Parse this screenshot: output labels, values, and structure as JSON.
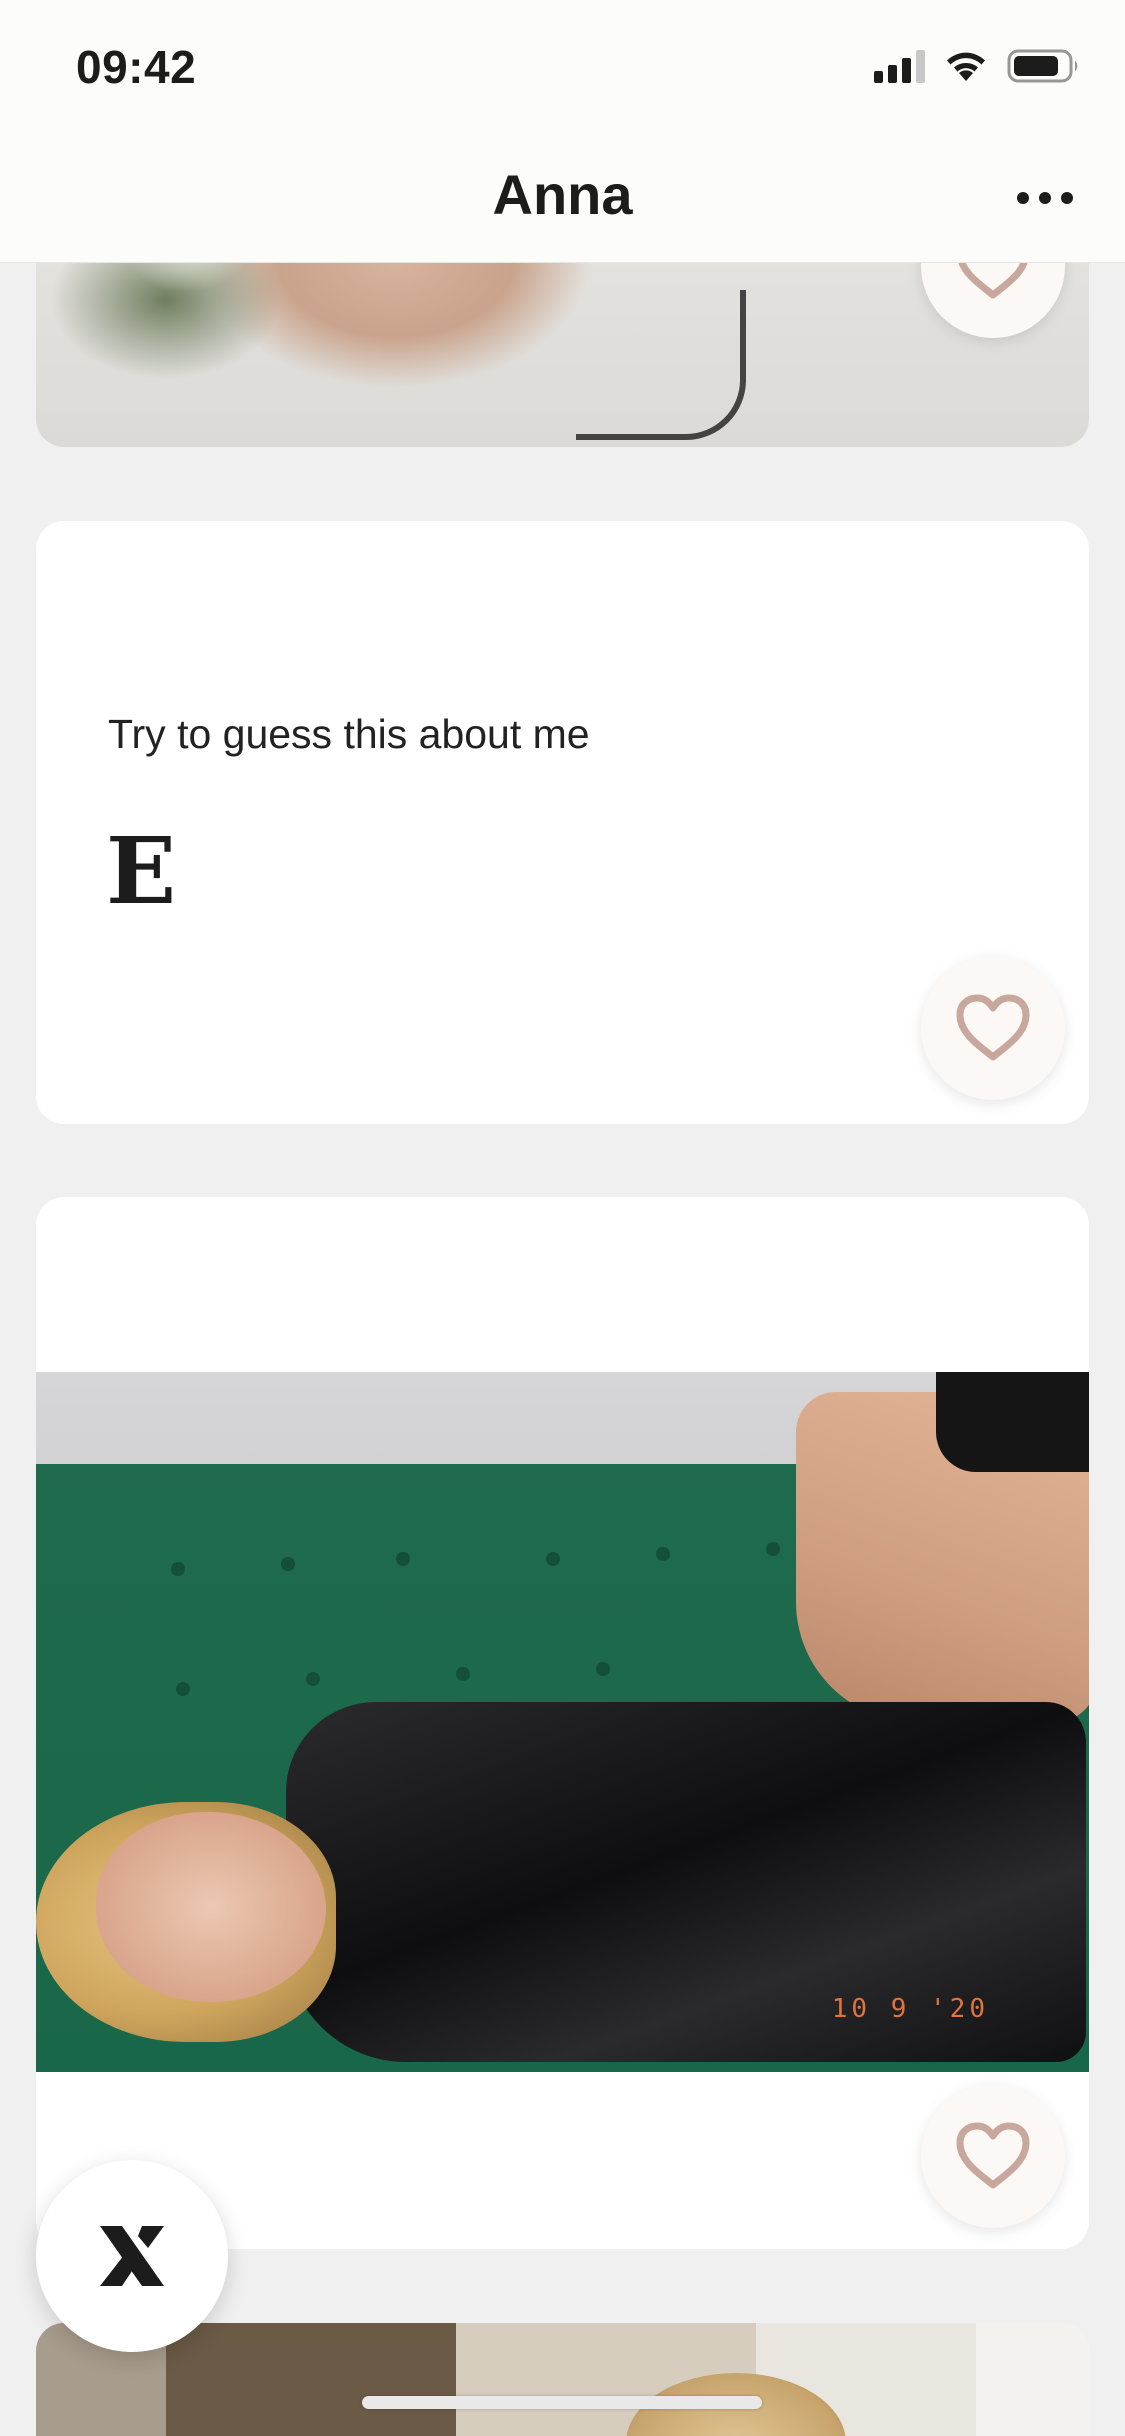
{
  "status_bar": {
    "time": "09:42"
  },
  "header": {
    "title": "Anna"
  },
  "prompt_card": {
    "label": "Try to guess this about me",
    "answer": "E"
  },
  "photo_card": {
    "date_stamp": "10 9 '20"
  },
  "icons": {
    "more": "more-horizontal-icon",
    "like": "heart-outline-icon",
    "pass": "close-x-icon"
  },
  "colors": {
    "heart": "#c8a89c",
    "background": "#f0f0f0",
    "card": "#ffffff"
  }
}
